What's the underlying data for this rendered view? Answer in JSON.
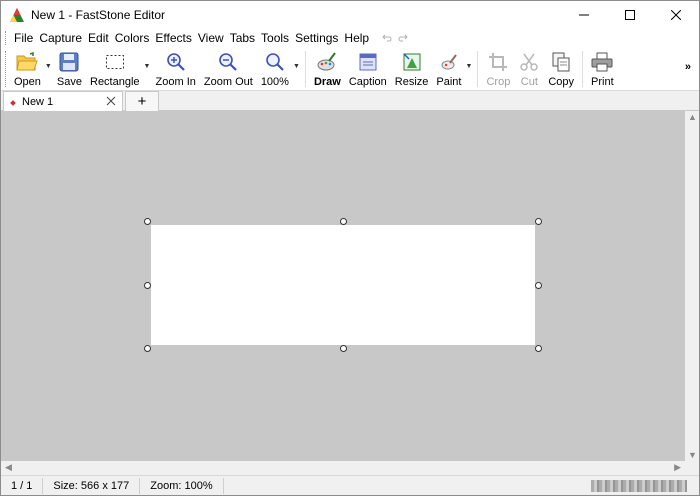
{
  "window": {
    "title": "New 1 - FastStone Editor"
  },
  "menu": {
    "items": [
      "File",
      "Capture",
      "Edit",
      "Colors",
      "Effects",
      "View",
      "Tabs",
      "Tools",
      "Settings",
      "Help"
    ]
  },
  "toolbar": {
    "open": "Open",
    "save": "Save",
    "rectangle": "Rectangle",
    "zoom_in": "Zoom In",
    "zoom_out": "Zoom Out",
    "zoom_level": "100%",
    "draw": "Draw",
    "caption": "Caption",
    "resize": "Resize",
    "paint": "Paint",
    "crop": "Crop",
    "cut": "Cut",
    "copy": "Copy",
    "print": "Print",
    "more": "»"
  },
  "tabs": {
    "doc_tab_label": "New 1",
    "new_tab": "+"
  },
  "status": {
    "page": "1 / 1",
    "size": "Size: 566 x 177",
    "zoom": "Zoom: 100%"
  },
  "colors": {
    "canvas_bg": "#c8c8c8",
    "accent_red": "#d32f2f"
  }
}
